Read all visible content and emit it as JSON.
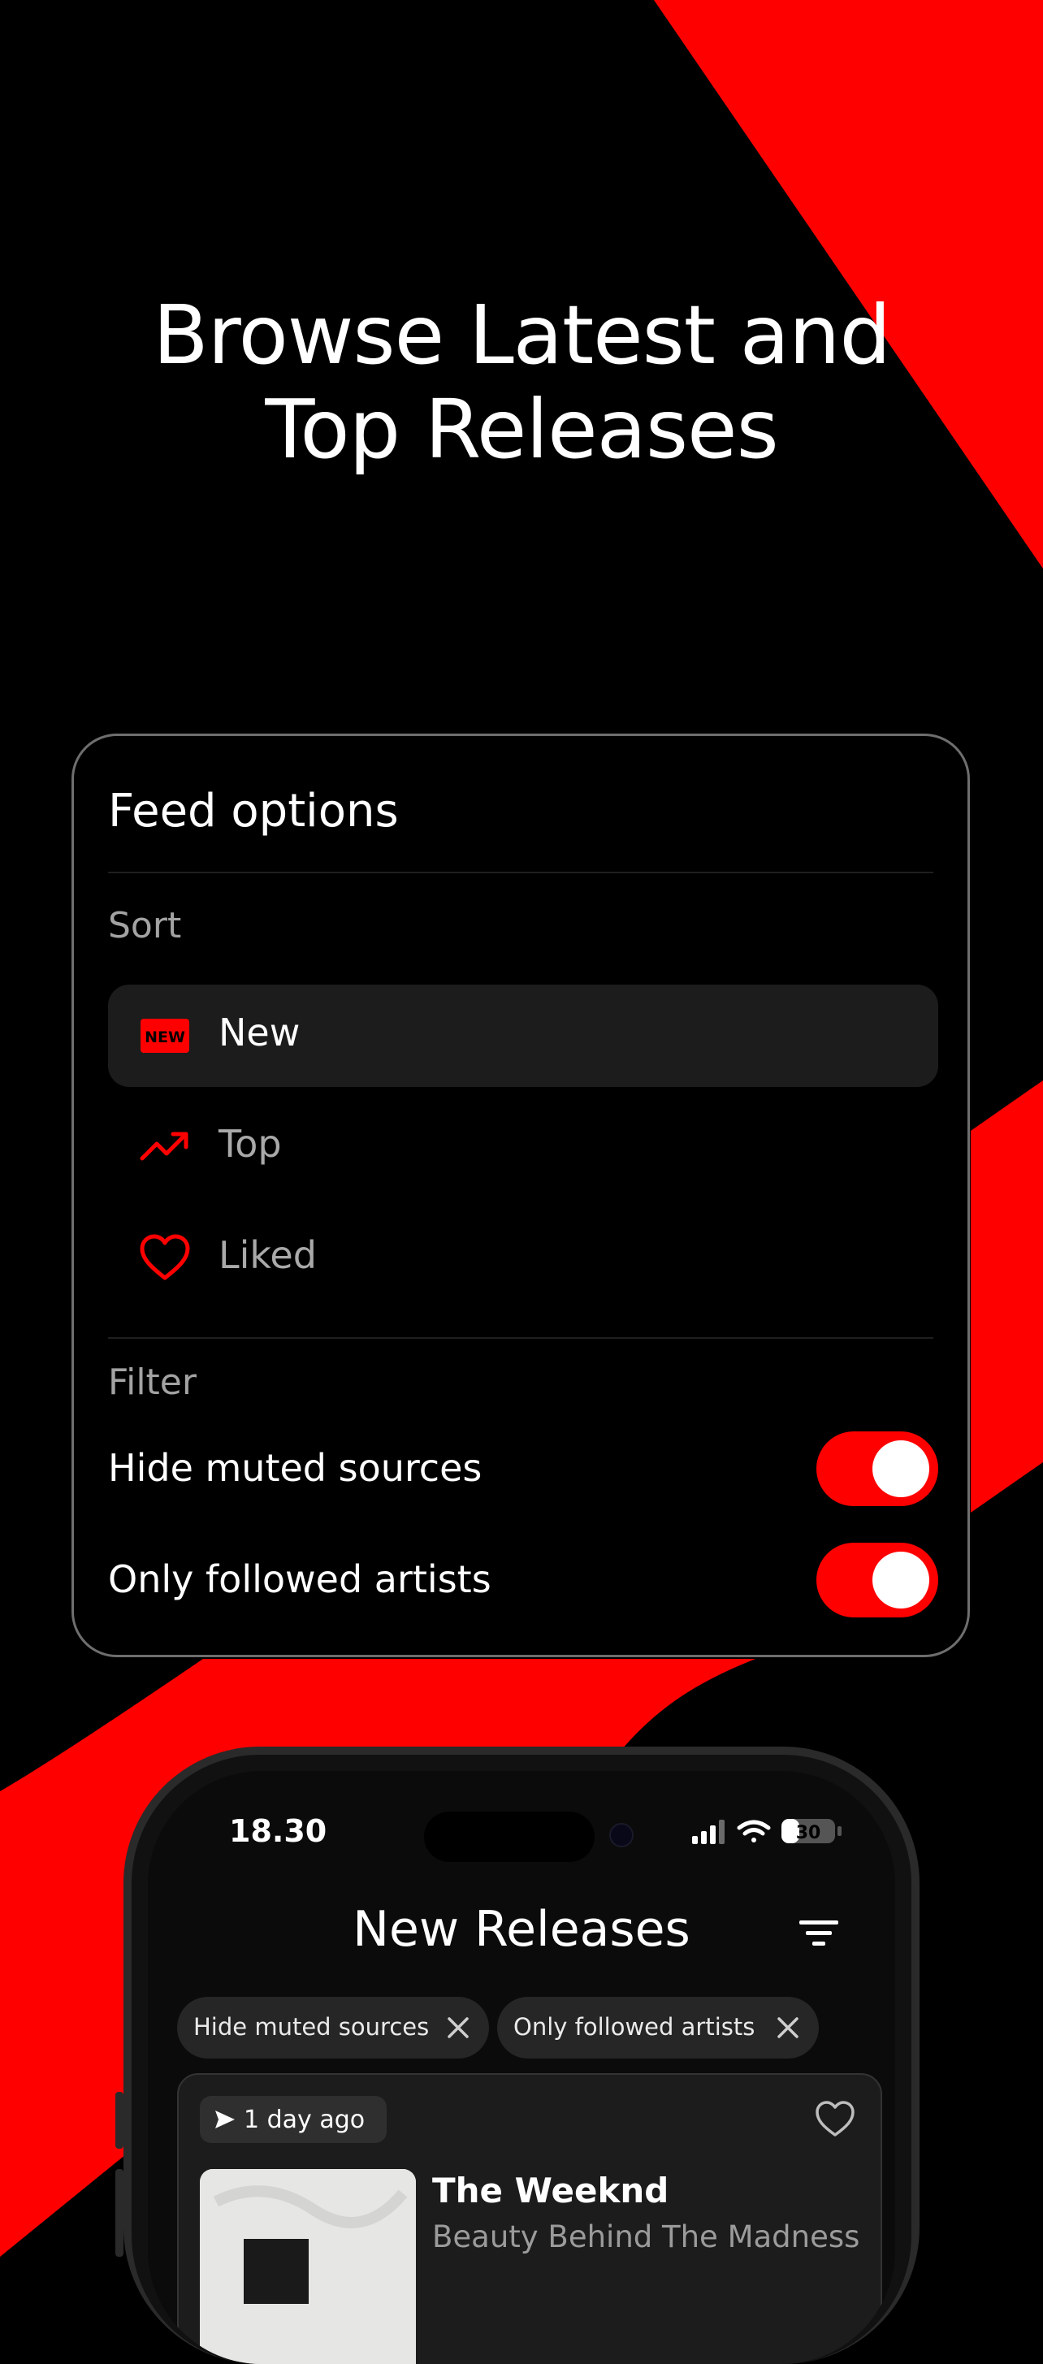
{
  "headline": {
    "line1": "Browse Latest and",
    "line2": "Top Releases"
  },
  "colors": {
    "accent": "#ff0000",
    "background": "#000000",
    "card_border": "#6e6e6e",
    "muted_text": "#a3a3a3"
  },
  "feed_options": {
    "title": "Feed options",
    "sort_label": "Sort",
    "sort_options": [
      {
        "label": "New",
        "icon": "new-badge-icon",
        "selected": true
      },
      {
        "label": "Top",
        "icon": "trending-up-icon",
        "selected": false
      },
      {
        "label": "Liked",
        "icon": "heart-icon",
        "selected": false
      }
    ],
    "new_badge_text": "NEW",
    "filter_label": "Filter",
    "filters": [
      {
        "label": "Hide muted sources",
        "enabled": true
      },
      {
        "label": "Only followed artists",
        "enabled": true
      }
    ]
  },
  "phone": {
    "status": {
      "time": "18.30",
      "battery": "30"
    },
    "nav_title": "New Releases",
    "filter_icon": "filter-lines-icon",
    "chips": [
      {
        "label": "Hide muted sources"
      },
      {
        "label": "Only followed artists"
      }
    ],
    "release": {
      "time_ago": "1 day ago",
      "artist": "The Weeknd",
      "album": "Beauty Behind The Madness"
    }
  }
}
